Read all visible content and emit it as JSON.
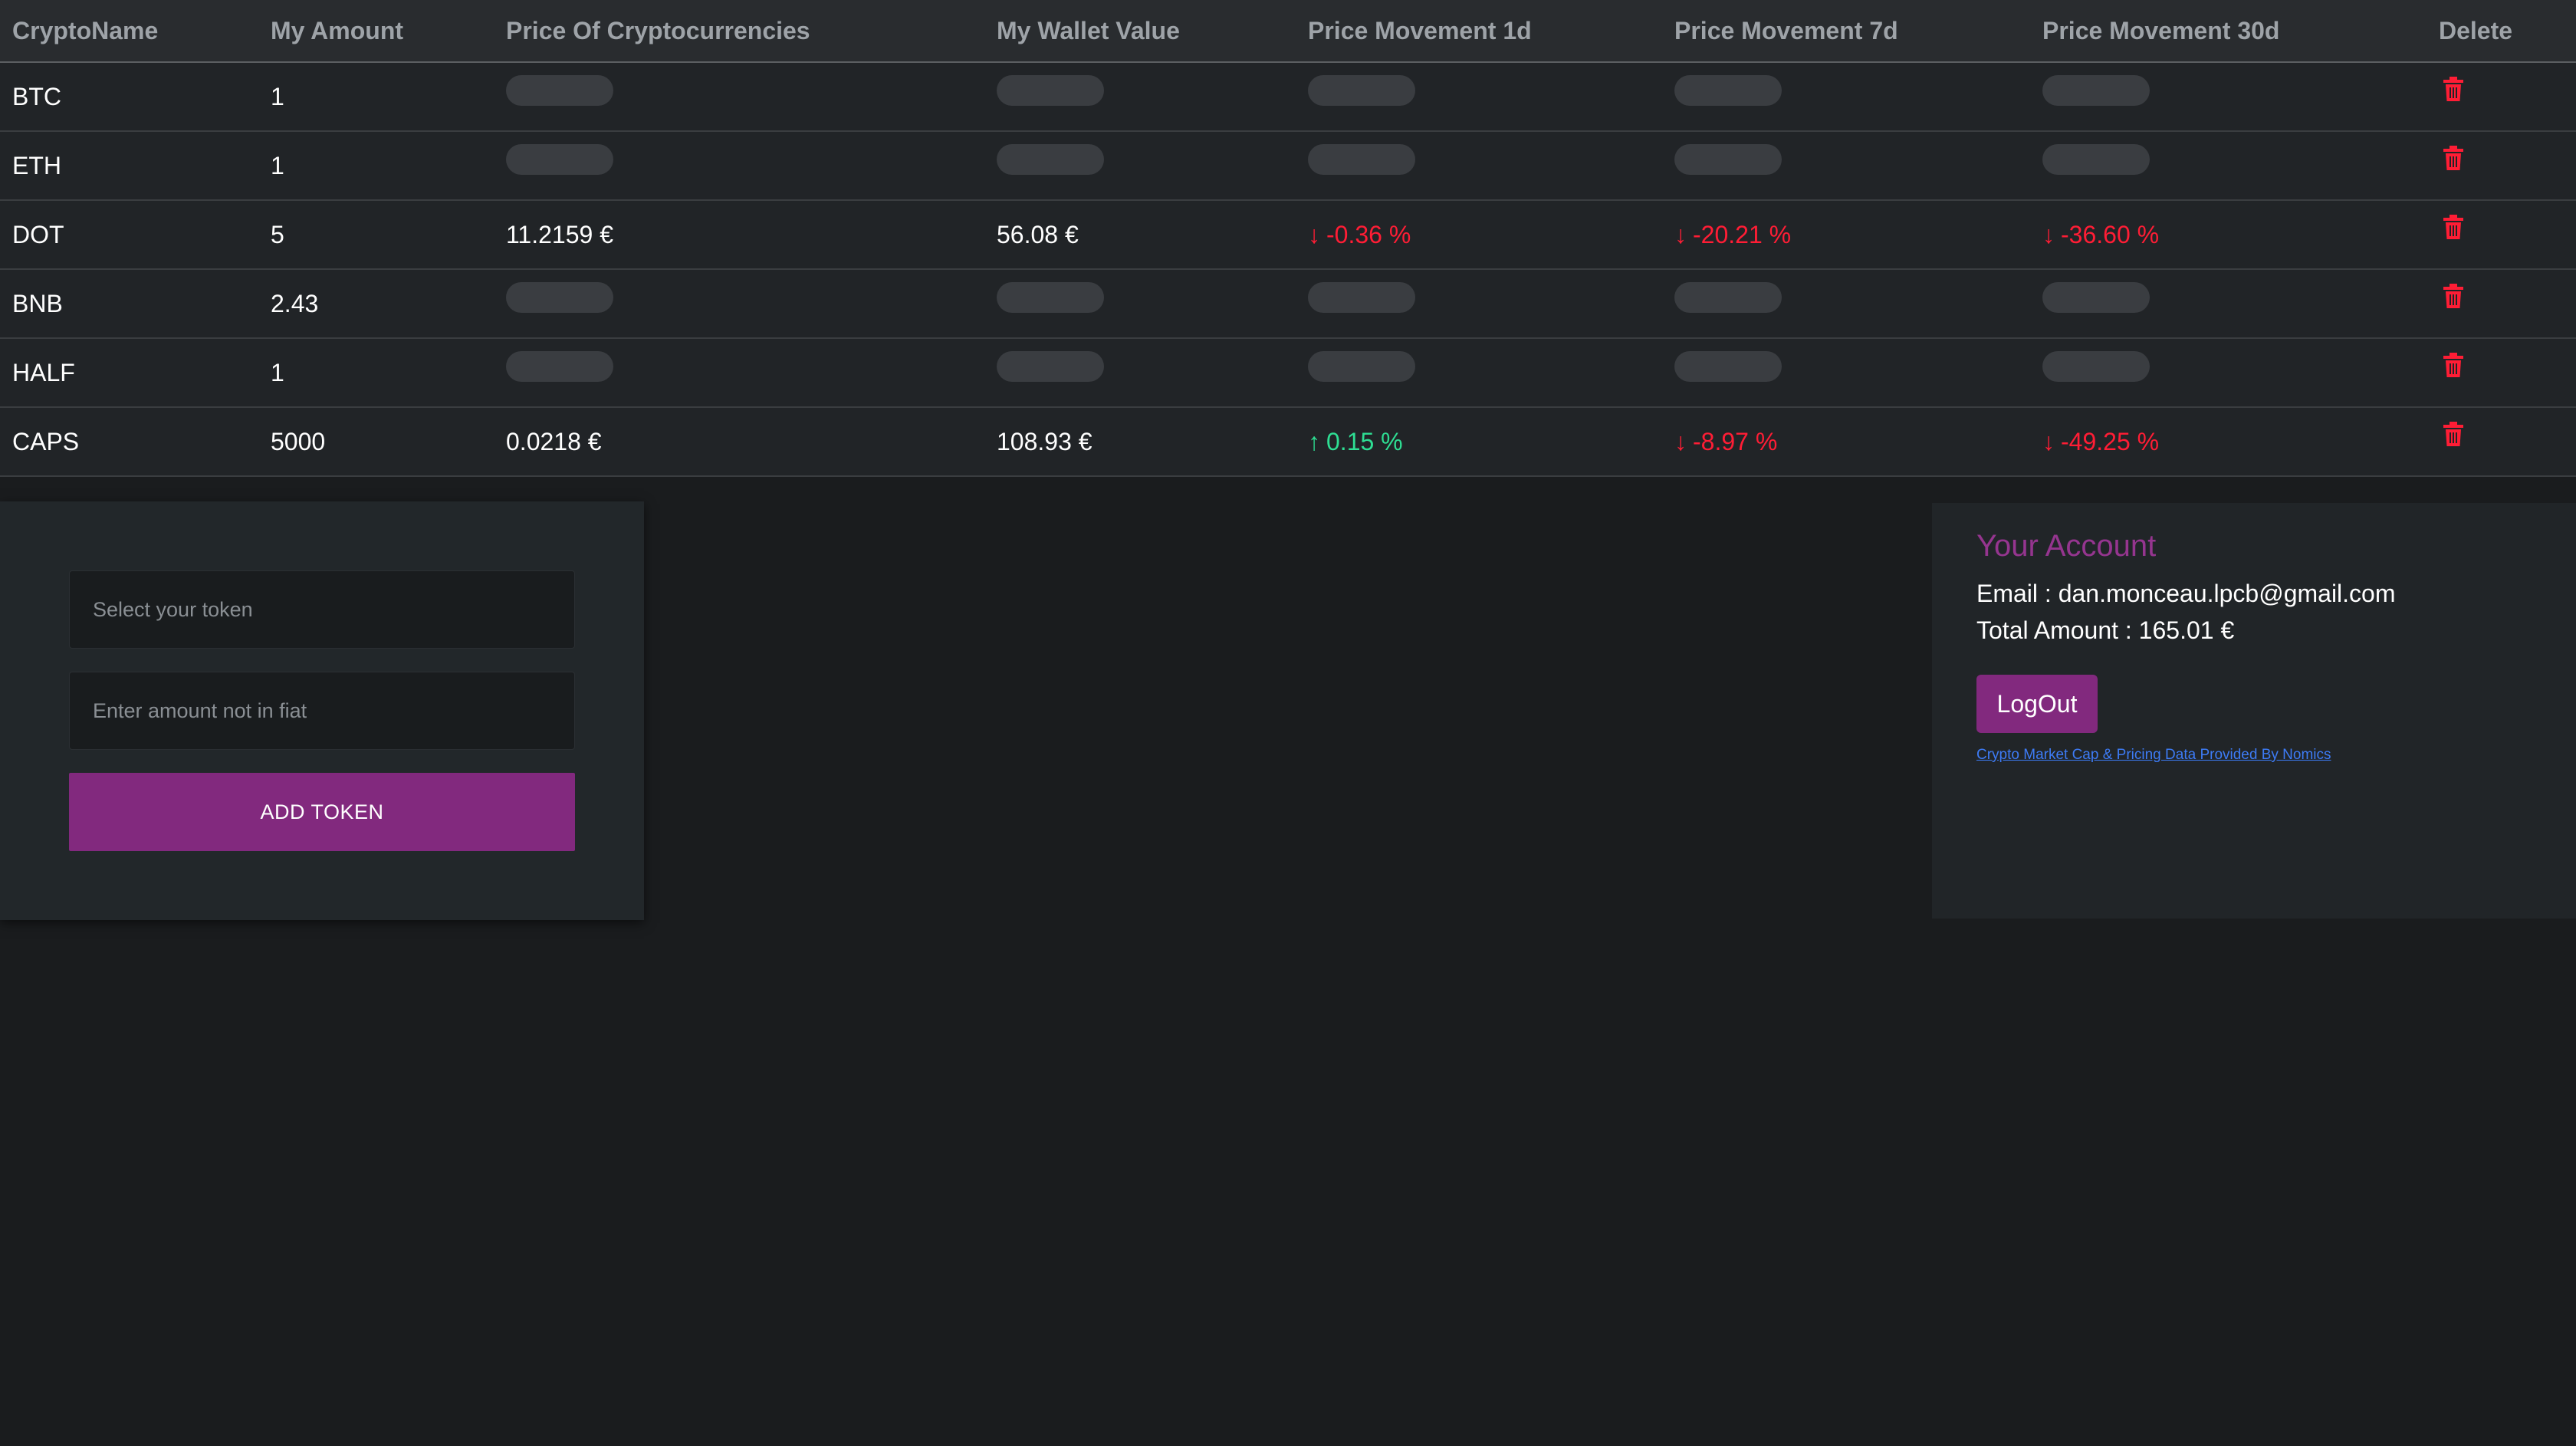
{
  "table": {
    "headers": [
      "CryptoName",
      "My Amount",
      "Price Of Cryptocurrencies",
      "My Wallet Value",
      "Price Movement 1d",
      "Price Movement 7d",
      "Price Movement 30d",
      "Delete"
    ],
    "rows": [
      {
        "name": "BTC",
        "amount": "1",
        "loaded": false
      },
      {
        "name": "ETH",
        "amount": "1",
        "loaded": false
      },
      {
        "name": "DOT",
        "amount": "5",
        "loaded": true,
        "price": "11.2159 €",
        "wallet": "56.08 €",
        "m1d": "-0.36 %",
        "m1d_dir": "down",
        "m7d": "-20.21 %",
        "m7d_dir": "down",
        "m30d": "-36.60 %",
        "m30d_dir": "down"
      },
      {
        "name": "BNB",
        "amount": "2.43",
        "loaded": false
      },
      {
        "name": "HALF",
        "amount": "1",
        "loaded": false
      },
      {
        "name": "CAPS",
        "amount": "5000",
        "loaded": true,
        "price": "0.0218 €",
        "wallet": "108.93 €",
        "m1d": "0.15 %",
        "m1d_dir": "up",
        "m7d": "-8.97 %",
        "m7d_dir": "down",
        "m30d": "-49.25 %",
        "m30d_dir": "down"
      }
    ],
    "delete_icon": "trash-icon"
  },
  "add_form": {
    "token_placeholder": "Select your token",
    "amount_placeholder": "Enter amount not in fiat",
    "add_label": "ADD TOKEN"
  },
  "account": {
    "title": "Your Account",
    "email_line": "Email : dan.monceau.lpcb@gmail.com",
    "total_line": "Total Amount : 165.01 €",
    "logout_label": "LogOut",
    "credit_link": "Crypto Market Cap & Pricing Data Provided By Nomics"
  },
  "colors": {
    "accent": "#82297e",
    "title": "#95358f",
    "down": "#ff1d35",
    "up": "#2ede93",
    "link": "#3d7bf5"
  }
}
